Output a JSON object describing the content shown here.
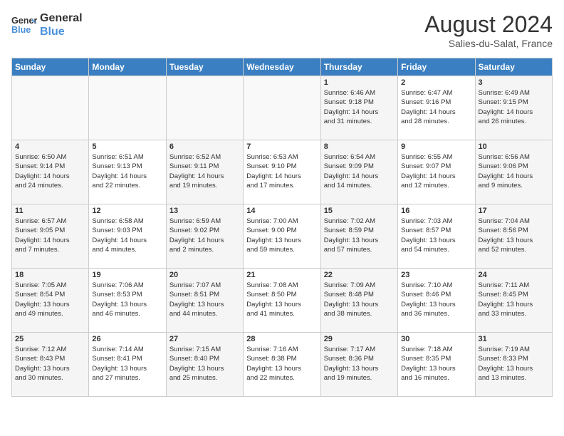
{
  "header": {
    "logo_line1": "General",
    "logo_line2": "Blue",
    "month_year": "August 2024",
    "location": "Salies-du-Salat, France"
  },
  "days_of_week": [
    "Sunday",
    "Monday",
    "Tuesday",
    "Wednesday",
    "Thursday",
    "Friday",
    "Saturday"
  ],
  "weeks": [
    [
      {
        "day": "",
        "info": ""
      },
      {
        "day": "",
        "info": ""
      },
      {
        "day": "",
        "info": ""
      },
      {
        "day": "",
        "info": ""
      },
      {
        "day": "1",
        "info": "Sunrise: 6:46 AM\nSunset: 9:18 PM\nDaylight: 14 hours\nand 31 minutes."
      },
      {
        "day": "2",
        "info": "Sunrise: 6:47 AM\nSunset: 9:16 PM\nDaylight: 14 hours\nand 28 minutes."
      },
      {
        "day": "3",
        "info": "Sunrise: 6:49 AM\nSunset: 9:15 PM\nDaylight: 14 hours\nand 26 minutes."
      }
    ],
    [
      {
        "day": "4",
        "info": "Sunrise: 6:50 AM\nSunset: 9:14 PM\nDaylight: 14 hours\nand 24 minutes."
      },
      {
        "day": "5",
        "info": "Sunrise: 6:51 AM\nSunset: 9:13 PM\nDaylight: 14 hours\nand 22 minutes."
      },
      {
        "day": "6",
        "info": "Sunrise: 6:52 AM\nSunset: 9:11 PM\nDaylight: 14 hours\nand 19 minutes."
      },
      {
        "day": "7",
        "info": "Sunrise: 6:53 AM\nSunset: 9:10 PM\nDaylight: 14 hours\nand 17 minutes."
      },
      {
        "day": "8",
        "info": "Sunrise: 6:54 AM\nSunset: 9:09 PM\nDaylight: 14 hours\nand 14 minutes."
      },
      {
        "day": "9",
        "info": "Sunrise: 6:55 AM\nSunset: 9:07 PM\nDaylight: 14 hours\nand 12 minutes."
      },
      {
        "day": "10",
        "info": "Sunrise: 6:56 AM\nSunset: 9:06 PM\nDaylight: 14 hours\nand 9 minutes."
      }
    ],
    [
      {
        "day": "11",
        "info": "Sunrise: 6:57 AM\nSunset: 9:05 PM\nDaylight: 14 hours\nand 7 minutes."
      },
      {
        "day": "12",
        "info": "Sunrise: 6:58 AM\nSunset: 9:03 PM\nDaylight: 14 hours\nand 4 minutes."
      },
      {
        "day": "13",
        "info": "Sunrise: 6:59 AM\nSunset: 9:02 PM\nDaylight: 14 hours\nand 2 minutes."
      },
      {
        "day": "14",
        "info": "Sunrise: 7:00 AM\nSunset: 9:00 PM\nDaylight: 13 hours\nand 59 minutes."
      },
      {
        "day": "15",
        "info": "Sunrise: 7:02 AM\nSunset: 8:59 PM\nDaylight: 13 hours\nand 57 minutes."
      },
      {
        "day": "16",
        "info": "Sunrise: 7:03 AM\nSunset: 8:57 PM\nDaylight: 13 hours\nand 54 minutes."
      },
      {
        "day": "17",
        "info": "Sunrise: 7:04 AM\nSunset: 8:56 PM\nDaylight: 13 hours\nand 52 minutes."
      }
    ],
    [
      {
        "day": "18",
        "info": "Sunrise: 7:05 AM\nSunset: 8:54 PM\nDaylight: 13 hours\nand 49 minutes."
      },
      {
        "day": "19",
        "info": "Sunrise: 7:06 AM\nSunset: 8:53 PM\nDaylight: 13 hours\nand 46 minutes."
      },
      {
        "day": "20",
        "info": "Sunrise: 7:07 AM\nSunset: 8:51 PM\nDaylight: 13 hours\nand 44 minutes."
      },
      {
        "day": "21",
        "info": "Sunrise: 7:08 AM\nSunset: 8:50 PM\nDaylight: 13 hours\nand 41 minutes."
      },
      {
        "day": "22",
        "info": "Sunrise: 7:09 AM\nSunset: 8:48 PM\nDaylight: 13 hours\nand 38 minutes."
      },
      {
        "day": "23",
        "info": "Sunrise: 7:10 AM\nSunset: 8:46 PM\nDaylight: 13 hours\nand 36 minutes."
      },
      {
        "day": "24",
        "info": "Sunrise: 7:11 AM\nSunset: 8:45 PM\nDaylight: 13 hours\nand 33 minutes."
      }
    ],
    [
      {
        "day": "25",
        "info": "Sunrise: 7:12 AM\nSunset: 8:43 PM\nDaylight: 13 hours\nand 30 minutes."
      },
      {
        "day": "26",
        "info": "Sunrise: 7:14 AM\nSunset: 8:41 PM\nDaylight: 13 hours\nand 27 minutes."
      },
      {
        "day": "27",
        "info": "Sunrise: 7:15 AM\nSunset: 8:40 PM\nDaylight: 13 hours\nand 25 minutes."
      },
      {
        "day": "28",
        "info": "Sunrise: 7:16 AM\nSunset: 8:38 PM\nDaylight: 13 hours\nand 22 minutes."
      },
      {
        "day": "29",
        "info": "Sunrise: 7:17 AM\nSunset: 8:36 PM\nDaylight: 13 hours\nand 19 minutes."
      },
      {
        "day": "30",
        "info": "Sunrise: 7:18 AM\nSunset: 8:35 PM\nDaylight: 13 hours\nand 16 minutes."
      },
      {
        "day": "31",
        "info": "Sunrise: 7:19 AM\nSunset: 8:33 PM\nDaylight: 13 hours\nand 13 minutes."
      }
    ]
  ]
}
